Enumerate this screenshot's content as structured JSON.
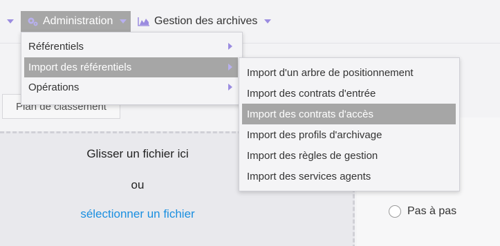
{
  "navbar": {
    "items": [
      {
        "label": "Administration",
        "icon": "gears-icon",
        "active": true
      },
      {
        "label": "Gestion des archives",
        "icon": "area-chart-icon",
        "active": false
      }
    ]
  },
  "menu": {
    "items": [
      {
        "label": "Référentiels",
        "has_submenu": true,
        "highlighted": false
      },
      {
        "label": "Import des référentiels",
        "has_submenu": true,
        "highlighted": true
      },
      {
        "label": "Opérations",
        "has_submenu": true,
        "highlighted": false
      }
    ]
  },
  "submenu": {
    "items": [
      {
        "label": "Import d'un arbre de positionnement",
        "highlighted": false
      },
      {
        "label": "Import des contrats d'entrée",
        "highlighted": false
      },
      {
        "label": "Import des contrats d'accès",
        "highlighted": true
      },
      {
        "label": "Import des profils d'archivage",
        "highlighted": false
      },
      {
        "label": "Import des règles de gestion",
        "highlighted": false
      },
      {
        "label": "Import des services agents",
        "highlighted": false
      }
    ]
  },
  "content": {
    "tab_label": "Plan de classement",
    "drop_title": "Glisser un fichier ici",
    "drop_or": "ou",
    "drop_link": "sélectionner un fichier",
    "radio_label": "Pas à pas"
  },
  "colors": {
    "accent": "#9b8ce0",
    "highlight": "#a6a6a6",
    "link": "#1a8fe0"
  }
}
